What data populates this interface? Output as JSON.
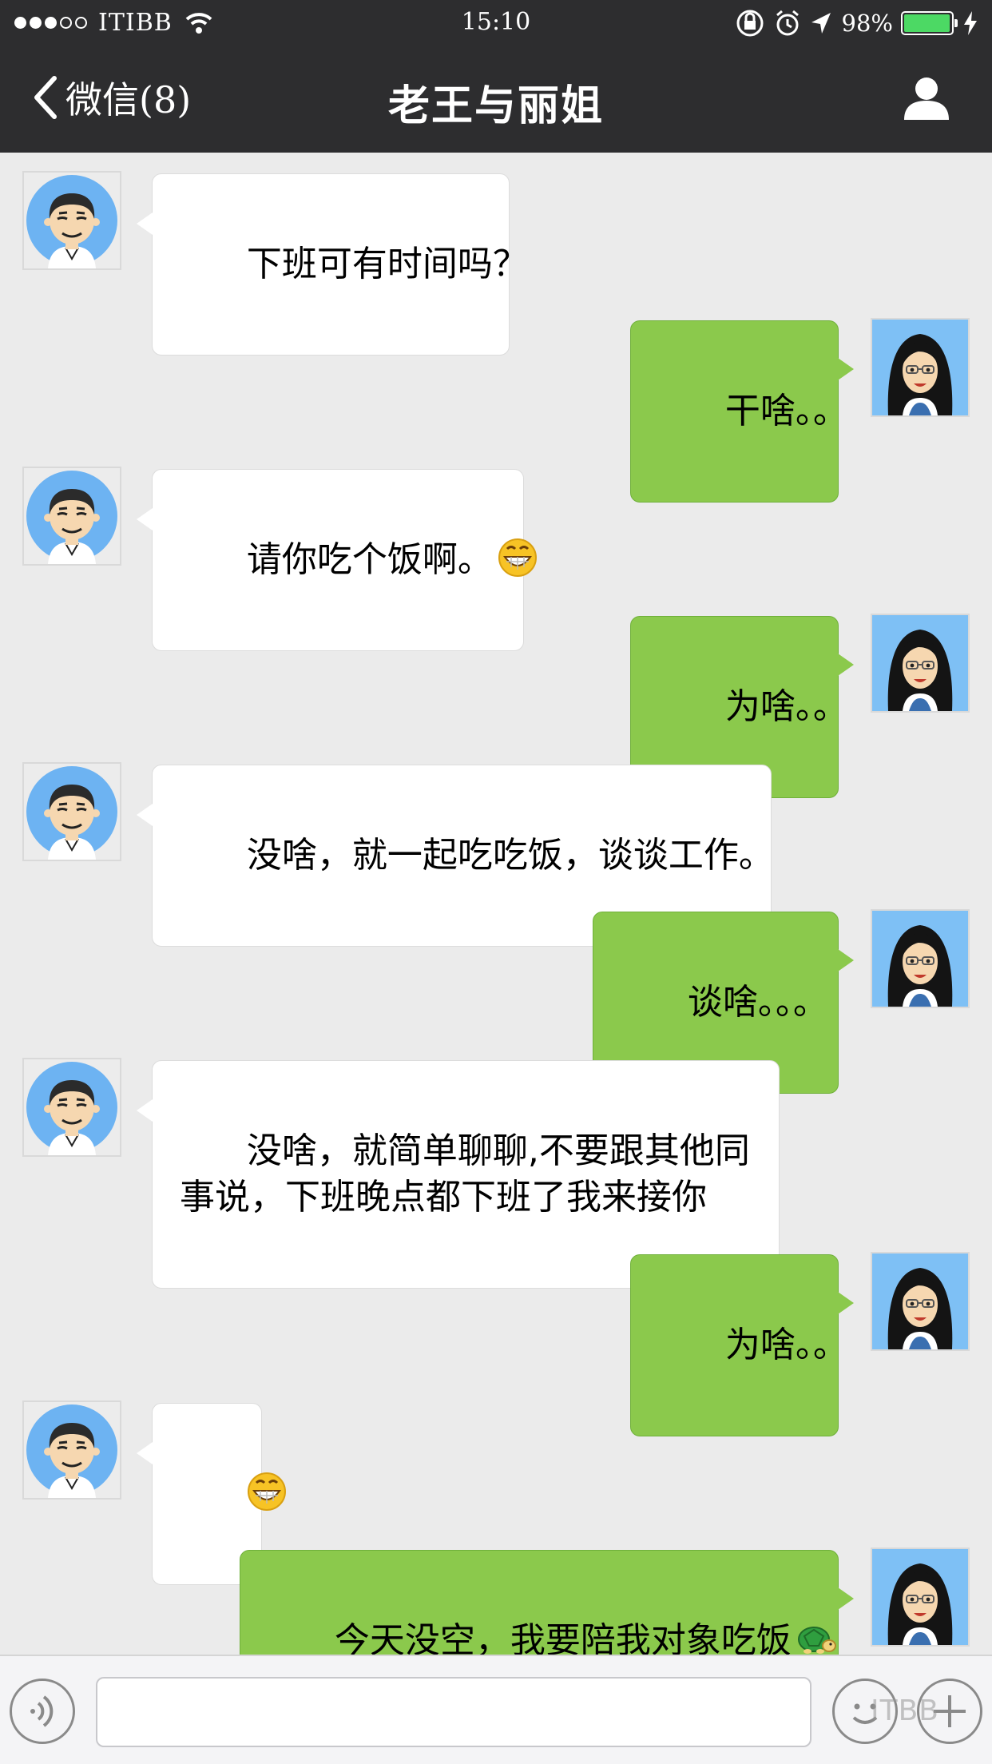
{
  "status_bar": {
    "carrier": "ITIBB",
    "time": "15:10",
    "battery": "98%",
    "battery_level": 0.98,
    "signal_dots_filled": 3,
    "signal_dots_total": 5
  },
  "nav": {
    "back_label": "微信(8)",
    "title": "老王与丽姐"
  },
  "messages": [
    {
      "side": "in",
      "text": "下班可有时间吗？"
    },
    {
      "side": "out",
      "text": "干啥。。"
    },
    {
      "side": "in",
      "text": "请你吃个饭啊。",
      "emoji": "grin-emoji"
    },
    {
      "side": "out",
      "text": "为啥。。"
    },
    {
      "side": "in",
      "text": "没啥，就一起吃吃饭，谈谈工作。"
    },
    {
      "side": "out",
      "text": "谈啥。。。"
    },
    {
      "side": "in",
      "text": "没啥，就简单聊聊,不要跟其他同\n事说，下班晚点都下班了我来接你"
    },
    {
      "side": "out",
      "text": "为啥。。"
    },
    {
      "side": "in",
      "text": "",
      "emoji": "grin-emoji"
    },
    {
      "side": "out",
      "text": "今天没空，我要陪我对象吃饭",
      "emoji": "turtle-emoji"
    }
  ],
  "input": {
    "value": "",
    "placeholder": ""
  },
  "watermark": "ITBB",
  "colors": {
    "topbar": "#2d2d2f",
    "background": "#ebebeb",
    "incoming_bubble": "#ffffff",
    "outgoing_bubble": "#8bc94c",
    "battery_fill": "#4cd964",
    "avatar_bg": "#6db3f2"
  }
}
